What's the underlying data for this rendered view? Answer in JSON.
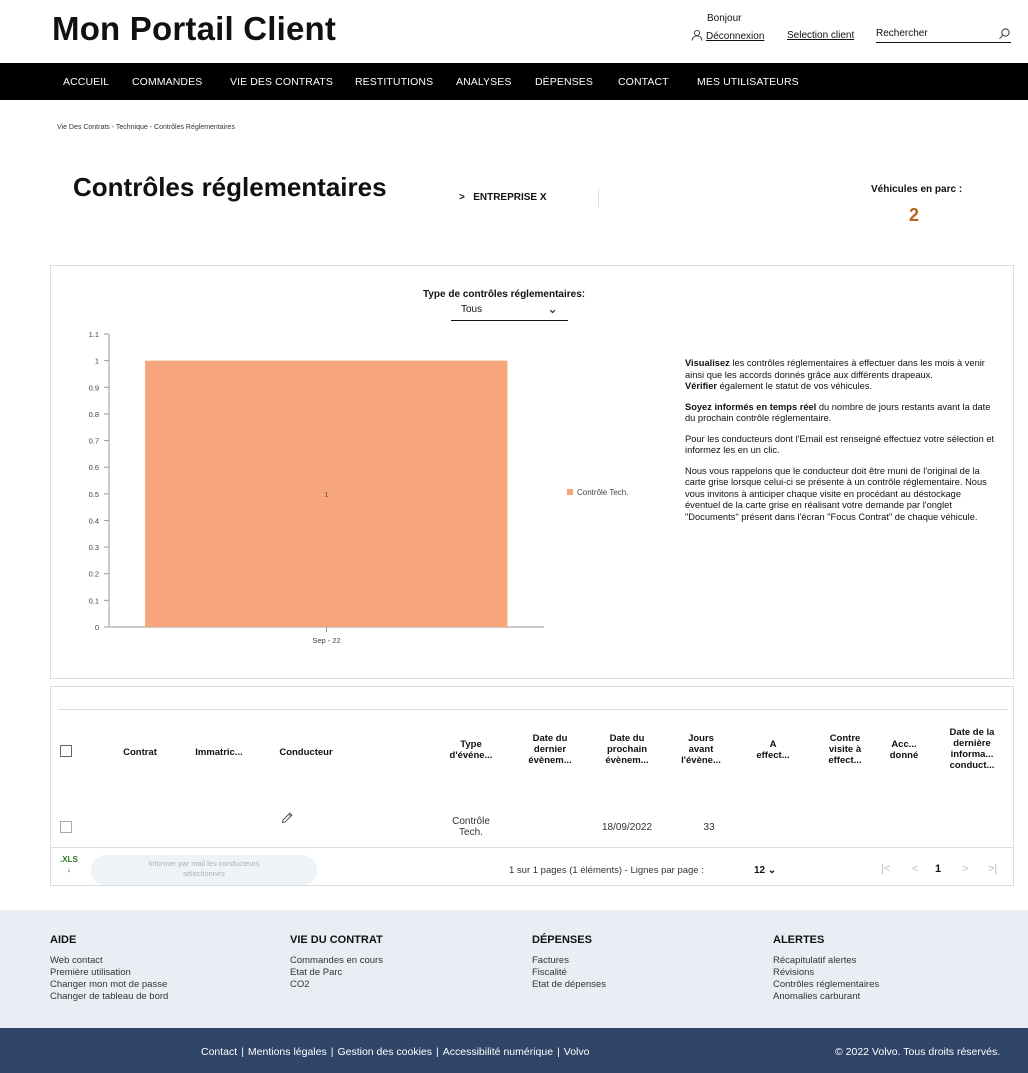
{
  "header": {
    "brand": "Mon Portail Client",
    "greeting": "Bonjour",
    "logout": "Déconnexion",
    "select_client": "Selection client",
    "search_placeholder": "Rechercher"
  },
  "nav": {
    "items": [
      "ACCUEIL",
      "COMMANDES",
      "VIE DES CONTRATS",
      "RESTITUTIONS",
      "ANALYSES",
      "DÉPENSES",
      "CONTACT",
      "MES UTILISATEURS"
    ]
  },
  "breadcrumb": "Vie Des Contrats - Technique - Contrôles Réglementaires",
  "page": {
    "title": "Contrôles réglementaires",
    "company": "ENTREPRISE X",
    "vehicles_label": "Véhicules en parc :",
    "vehicles_value": "2"
  },
  "filter": {
    "label": "Type de contrôles réglementaires:",
    "selected": "Tous"
  },
  "chart_data": {
    "type": "bar",
    "categories": [
      "Sep - 22"
    ],
    "series": [
      {
        "name": "Contrôle Tech.",
        "values": [
          1
        ],
        "color": "#f7a57b"
      }
    ],
    "data_labels": [
      "1"
    ],
    "ylim": [
      0,
      1.1
    ],
    "yticks": [
      "0",
      "0.1",
      "0.2",
      "0.3",
      "0.4",
      "0.5",
      "0.6",
      "0.7",
      "0.8",
      "0.9",
      "1",
      "1.1"
    ],
    "legend": "right",
    "grid": false
  },
  "info": {
    "p1_b": "Visualisez",
    "p1": " les contrôles réglementaires à effectuer dans les mois à venir ainsi que les accords donnés grâce aux différents drapeaux.",
    "p1b_b": "Vérifier",
    "p1b": " également le statut de vos véhicules.",
    "p2_b": "Soyez informés en temps réel",
    "p2": " du nombre de jours restants avant la date du prochain contrôle réglementaire.",
    "p3": "Pour les conducteurs dont l'Email est renseigné effectuez votre sélection et informez les en un clic.",
    "p4": "Nous vous rappelons que le conducteur doit être muni de l'original de la carte grise lorsque celui-ci se présente à un contrôle réglementaire. Nous vous invitons à anticiper chaque visite en procédant au déstockage éventuel de la carte grise en réalisant votre demande par l'onglet \"Documents\" présent dans l'écran \"Focus Contrat\" de chaque véhicule."
  },
  "table": {
    "headers": {
      "contrat": "Contrat",
      "immat": "Immatric...",
      "conducteur": "Conducteur",
      "type_l1": "Type",
      "type_l2": "d'événe...",
      "dd_l1": "Date du",
      "dd_l2": "dernier",
      "dd_l3": "évènem...",
      "dp_l1": "Date du",
      "dp_l2": "prochain",
      "dp_l3": "évènem...",
      "j_l1": "Jours",
      "j_l2": "avant",
      "j_l3": "l'évène...",
      "a_l1": "A",
      "a_l2": "effect...",
      "cv_l1": "Contre",
      "cv_l2": "visite à",
      "cv_l3": "effect...",
      "acc_l1": "Acc...",
      "acc_l2": "donné",
      "dl_l1": "Date de la",
      "dl_l2": "dernière",
      "dl_l3": "informa...",
      "dl_l4": "conduct..."
    },
    "row": {
      "type_l1": "Contrôle",
      "type_l2": "Tech.",
      "next_date": "18/09/2022",
      "days": "33"
    },
    "footer": {
      "xls_label": ".XLS",
      "mail_l1": "Informer par mail les conducteurs",
      "mail_l2": "sélectionnés",
      "pages": "1 sur 1 pages (1 éléments) - Lignes par page :",
      "rows_per_page": "12",
      "page_number": "1"
    }
  },
  "footer": {
    "aide": {
      "title": "AIDE",
      "links": [
        "Web contact",
        "Première utilisation",
        "Changer mon mot de passe",
        "Changer de tableau de bord"
      ]
    },
    "vie": {
      "title": "VIE DU CONTRAT",
      "links": [
        "Commandes en cours",
        "Etat de Parc",
        "CO2"
      ]
    },
    "depenses": {
      "title": "DÉPENSES",
      "links": [
        "Factures",
        "Fiscalité",
        "Etat de dépenses"
      ]
    },
    "alertes": {
      "title": "ALERTES",
      "links": [
        "Récapitulatif alertes",
        "Révisions",
        "Contrôles réglementaires",
        "Anomalies carburant"
      ]
    }
  },
  "bottom": {
    "links": [
      "Contact",
      "Mentions légales",
      "Gestion des cookies",
      "Accessibilité numérique",
      "Volvo"
    ],
    "copyright": "© 2022 Volvo. Tous droits réservés."
  }
}
